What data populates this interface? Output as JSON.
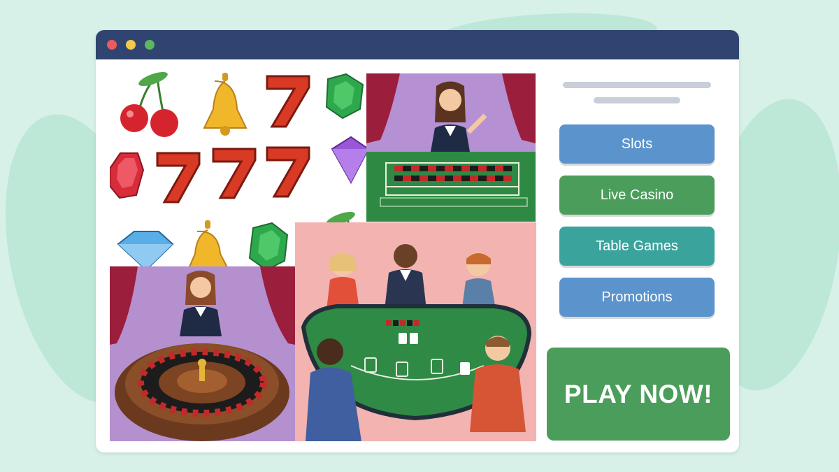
{
  "window": {
    "controls": [
      {
        "name": "close",
        "color": "#ee5a5a"
      },
      {
        "name": "minimize",
        "color": "#f2c94c"
      },
      {
        "name": "maximize",
        "color": "#5cb85c"
      }
    ]
  },
  "nav": {
    "slots": "Slots",
    "live_casino": "Live Casino",
    "table_games": "Table Games",
    "promotions": "Promotions"
  },
  "cta": {
    "play_now": "PLAY NOW!"
  },
  "colors": {
    "background": "#d8f1e8",
    "titlebar": "#2f4470",
    "slots_button": "#5b93cc",
    "live_casino_button": "#4a9d5a",
    "table_games_button": "#3aa39c",
    "promotions_button": "#5b93cc",
    "play_button": "#4a9d5a"
  },
  "illustrations": {
    "symbols": [
      "cherry-icon",
      "bell-icon",
      "seven-icon",
      "emerald-icon",
      "ruby-icon",
      "amethyst-icon",
      "diamond-icon"
    ],
    "scenes": [
      "live-dealer-roulette-table",
      "roulette-wheel-dealer",
      "blackjack-table"
    ]
  }
}
